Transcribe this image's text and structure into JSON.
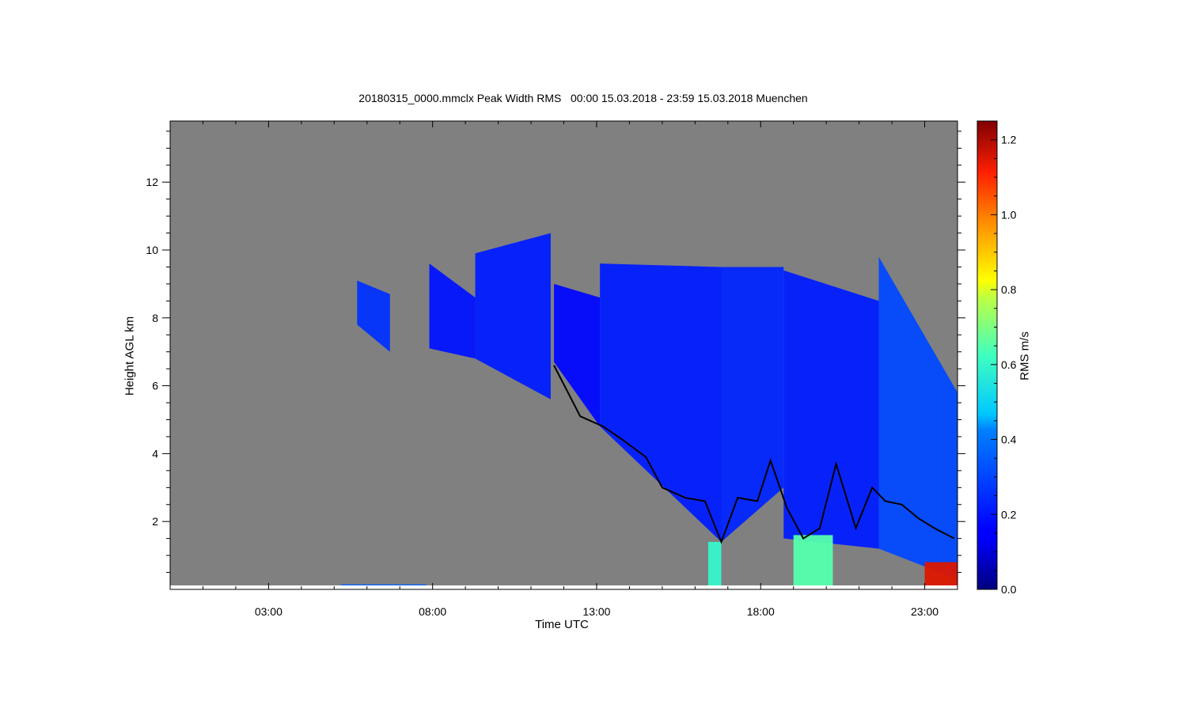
{
  "chart_data": {
    "type": "heatmap",
    "title": "20180315_0000.mmclx Peak Width RMS   00:00 15.03.2018 - 23:59 15.03.2018 Muenchen",
    "xlabel": "Time UTC",
    "ylabel": "Height AGL km",
    "colorbar_label": "RMS m/s",
    "x_unit": "hours UTC",
    "xlim": [
      0,
      24
    ],
    "ylim": [
      0,
      13.8
    ],
    "x_ticks": [
      3,
      8,
      13,
      18,
      23
    ],
    "x_tick_labels": [
      "03:00",
      "08:00",
      "13:00",
      "18:00",
      "23:00"
    ],
    "y_ticks": [
      2,
      4,
      6,
      8,
      10,
      12
    ],
    "y_tick_labels": [
      "2",
      "4",
      "6",
      "8",
      "10",
      "12"
    ],
    "colorbar_range": [
      0.0,
      1.25
    ],
    "colorbar_ticks": [
      0.0,
      0.2,
      0.4,
      0.6,
      0.8,
      1.0,
      1.2
    ],
    "colorbar_tick_labels": [
      "0.0",
      "0.2",
      "0.4",
      "0.6",
      "0.8",
      "1.0",
      "1.2"
    ],
    "colormap": "jet",
    "colors": {
      "background": "#808080",
      "cloud_base_line": "#000000"
    },
    "cloud_base": {
      "x": [
        11.7,
        12.5,
        13.2,
        13.8,
        14.5,
        15.0,
        15.7,
        16.3,
        16.8,
        17.3,
        17.9,
        18.3,
        18.8,
        19.3,
        19.8,
        20.3,
        20.9,
        21.4,
        21.8,
        22.3,
        22.8,
        23.3,
        23.9
      ],
      "y": [
        6.6,
        5.1,
        4.8,
        4.4,
        3.9,
        3.0,
        2.7,
        2.6,
        1.4,
        2.7,
        2.6,
        3.8,
        2.4,
        1.5,
        1.8,
        3.7,
        1.8,
        3.0,
        2.6,
        2.5,
        2.1,
        1.8,
        1.5
      ]
    },
    "cloud_regions": [
      {
        "x": [
          5.7,
          6.7
        ],
        "y_bottom": [
          7.8,
          7.0
        ],
        "y_top": [
          9.1,
          8.7
        ],
        "rms": 0.25
      },
      {
        "x": [
          7.9,
          9.3
        ],
        "y_bottom": [
          7.1,
          6.8
        ],
        "y_top": [
          9.6,
          8.6
        ],
        "rms": 0.18
      },
      {
        "x": [
          9.3,
          11.6
        ],
        "y_bottom": [
          6.8,
          5.6
        ],
        "y_top": [
          9.9,
          10.5
        ],
        "rms": 0.2
      },
      {
        "x": [
          11.7,
          13.1
        ],
        "y_bottom": [
          6.7,
          4.8
        ],
        "y_top": [
          9.0,
          8.6
        ],
        "rms": 0.15
      },
      {
        "x": [
          13.1,
          16.8
        ],
        "y_bottom": [
          4.8,
          1.4
        ],
        "y_top": [
          9.6,
          9.5
        ],
        "rms": 0.2
      },
      {
        "x": [
          16.8,
          18.7
        ],
        "y_bottom": [
          1.4,
          3.0
        ],
        "y_top": [
          9.5,
          9.5
        ],
        "rms": 0.22
      },
      {
        "x": [
          18.7,
          21.6
        ],
        "y_bottom": [
          1.5,
          1.2
        ],
        "y_top": [
          9.4,
          8.5
        ],
        "rms": 0.2
      },
      {
        "x": [
          21.6,
          24.0
        ],
        "y_bottom": [
          1.2,
          0.3
        ],
        "y_top": [
          9.8,
          5.8
        ],
        "rms": 0.3
      },
      {
        "x": [
          16.4,
          16.8
        ],
        "y_bottom": [
          0.0,
          0.0
        ],
        "y_top": [
          1.4,
          1.4
        ],
        "rms": 0.6
      },
      {
        "x": [
          19.0,
          20.2
        ],
        "y_bottom": [
          0.0,
          0.0
        ],
        "y_top": [
          1.6,
          1.6
        ],
        "rms": 0.65
      },
      {
        "x": [
          23.0,
          24.0
        ],
        "y_bottom": [
          0.0,
          0.0
        ],
        "y_top": [
          0.8,
          0.8
        ],
        "rms": 1.15
      },
      {
        "x": [
          5.2,
          7.8
        ],
        "y_bottom": [
          0.0,
          0.0
        ],
        "y_top": [
          0.15,
          0.15
        ],
        "rms": 0.35
      }
    ]
  }
}
